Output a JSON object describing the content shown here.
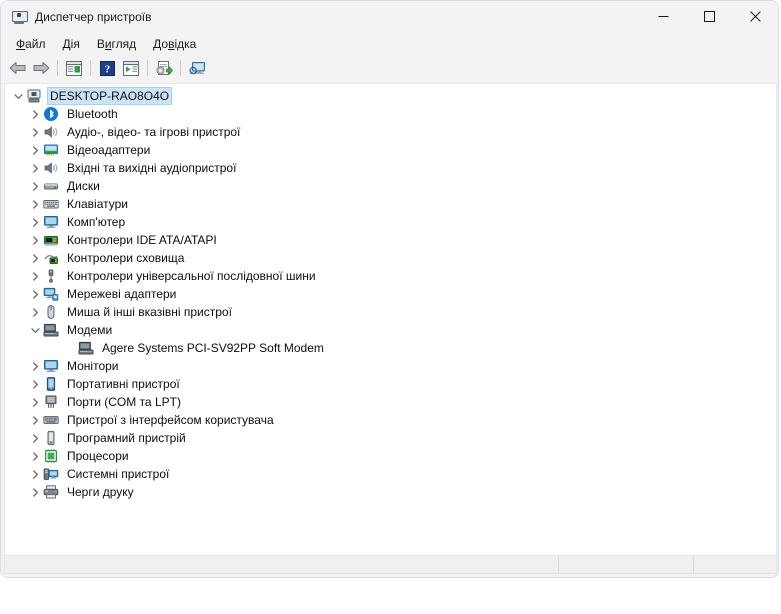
{
  "window": {
    "title": "Диспетчер пристроїв",
    "icon": "device-manager-icon",
    "caption": {
      "minimize": "–",
      "maximize": "□",
      "close": "✕"
    }
  },
  "menubar": {
    "items": [
      {
        "label": "Файл",
        "accel_index": 0
      },
      {
        "label": "Дія",
        "accel_index": 0
      },
      {
        "label": "Вигляд",
        "accel_index": 1
      },
      {
        "label": "Довідка",
        "accel_index": 2
      }
    ]
  },
  "toolbar": {
    "buttons": [
      {
        "name": "back-button",
        "icon": "back-arrow-icon",
        "enabled": true
      },
      {
        "name": "forward-button",
        "icon": "forward-arrow-icon",
        "enabled": true
      },
      {
        "name": "separator-1",
        "icon": "separator"
      },
      {
        "name": "properties-button",
        "icon": "properties-icon"
      },
      {
        "name": "separator-2",
        "icon": "separator"
      },
      {
        "name": "help-button",
        "icon": "help-question-icon"
      },
      {
        "name": "update-driver-button",
        "icon": "panel-play-icon"
      },
      {
        "name": "separator-3",
        "icon": "separator"
      },
      {
        "name": "scan-hardware-changes-button",
        "icon": "scan-hardware-icon"
      },
      {
        "name": "separator-4",
        "icon": "separator"
      },
      {
        "name": "show-devices-button",
        "icon": "monitor-search-icon"
      }
    ]
  },
  "tree": {
    "root": {
      "label": "DESKTOP-RAO8O4O",
      "icon": "computer-root-icon",
      "expanded": true,
      "selected": true
    },
    "nodes": [
      {
        "label": "Bluetooth",
        "icon": "bluetooth-icon",
        "expanded": false,
        "level": 1
      },
      {
        "label": "Аудіо-, відео- та ігрові пристрої",
        "icon": "speaker-icon",
        "expanded": false,
        "level": 1
      },
      {
        "label": "Відеоадаптери",
        "icon": "display-adapter-icon",
        "expanded": false,
        "level": 1
      },
      {
        "label": "Вхідні та вихідні аудіопристрої",
        "icon": "speaker-icon",
        "expanded": false,
        "level": 1
      },
      {
        "label": "Диски",
        "icon": "disk-drive-icon",
        "expanded": false,
        "level": 1
      },
      {
        "label": "Клавіатури",
        "icon": "keyboard-icon",
        "expanded": false,
        "level": 1
      },
      {
        "label": "Комп'ютер",
        "icon": "computer-icon",
        "expanded": false,
        "level": 1
      },
      {
        "label": "Контролери IDE ATA/ATAPI",
        "icon": "ide-controller-icon",
        "expanded": false,
        "level": 1
      },
      {
        "label": "Контролери сховища",
        "icon": "storage-controller-icon",
        "expanded": false,
        "level": 1
      },
      {
        "label": "Контролери універсальної послідовної шини",
        "icon": "usb-controller-icon",
        "expanded": false,
        "level": 1
      },
      {
        "label": "Мережеві адаптери",
        "icon": "network-adapter-icon",
        "expanded": false,
        "level": 1
      },
      {
        "label": "Миша й інші вказівні пристрої",
        "icon": "mouse-icon",
        "expanded": false,
        "level": 1
      },
      {
        "label": "Модеми",
        "icon": "modem-icon",
        "expanded": true,
        "level": 1
      },
      {
        "label": "Agere Systems PCI-SV92PP Soft Modem",
        "icon": "modem-device-icon",
        "expanded": null,
        "level": 2
      },
      {
        "label": "Монітори",
        "icon": "monitor-icon",
        "expanded": false,
        "level": 1
      },
      {
        "label": "Портативні пристрої",
        "icon": "portable-device-icon",
        "expanded": false,
        "level": 1
      },
      {
        "label": "Порти (COM та LPT)",
        "icon": "ports-icon",
        "expanded": false,
        "level": 1
      },
      {
        "label": "Пристрої з інтерфейсом користувача",
        "icon": "hid-icon",
        "expanded": false,
        "level": 1
      },
      {
        "label": "Програмний пристрій",
        "icon": "software-device-icon",
        "expanded": false,
        "level": 1
      },
      {
        "label": "Процесори",
        "icon": "processor-icon",
        "expanded": false,
        "level": 1
      },
      {
        "label": "Системні пристрої",
        "icon": "system-device-icon",
        "expanded": false,
        "level": 1
      },
      {
        "label": "Черги друку",
        "icon": "printer-icon",
        "expanded": false,
        "level": 1
      }
    ]
  },
  "statusbar": {
    "pane1": "",
    "pane2": "",
    "pane3": ""
  },
  "colors": {
    "selection": "#cce4f7",
    "window_bg": "#f3f3f3",
    "panel_bg": "#ffffff",
    "accent_blue": "#0a6ed1"
  }
}
